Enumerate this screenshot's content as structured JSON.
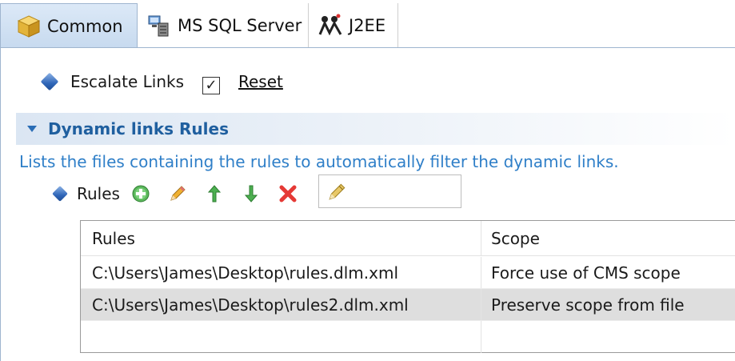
{
  "tabs": [
    {
      "label": "Common",
      "icon": "package-icon",
      "active": true
    },
    {
      "label": "MS SQL Server",
      "icon": "database-server-icon",
      "active": false
    },
    {
      "label": "J2EE",
      "icon": "j2ee-icon",
      "active": false
    }
  ],
  "escalate": {
    "label": "Escalate Links",
    "checked": true,
    "check_glyph": "✓",
    "reset_label": "Reset"
  },
  "section": {
    "title": "Dynamic links Rules",
    "description": "Lists the files containing the rules to automatically filter the dynamic links."
  },
  "rules_toolbar": {
    "label": "Rules",
    "buttons": [
      "add-icon",
      "edit-icon",
      "move-up-icon",
      "move-down-icon",
      "delete-icon"
    ],
    "filter_icon": "pen-filter-icon"
  },
  "table": {
    "headers": [
      "Rules",
      "Scope"
    ],
    "rows": [
      {
        "rule": "C:\\Users\\James\\Desktop\\rules.dlm.xml",
        "scope": "Force use of CMS scope",
        "selected": false
      },
      {
        "rule": "C:\\Users\\James\\Desktop\\rules2.dlm.xml",
        "scope": "Preserve scope from file",
        "selected": true
      }
    ]
  },
  "colors": {
    "section_title": "#1f5f9f",
    "description": "#2f7fc8",
    "selected_row": "#dedede",
    "tab_active": "#c7daef"
  }
}
